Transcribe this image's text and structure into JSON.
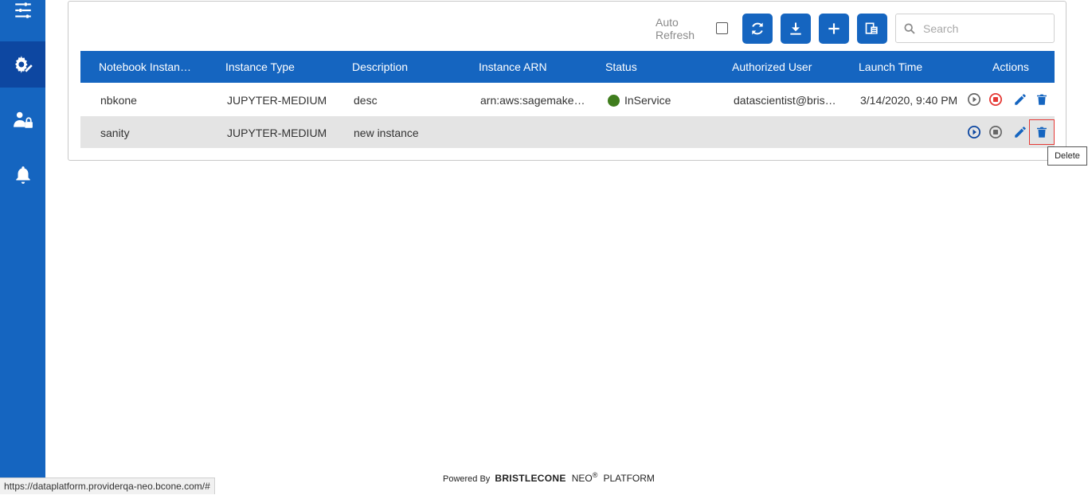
{
  "colors": {
    "primary": "#1565c0",
    "sidebar_active": "#0d47a1",
    "status_green": "#3f7d1d",
    "stop_red": "#e53935"
  },
  "sidebar": {
    "items": [
      {
        "icon": "sliders-icon"
      },
      {
        "icon": "gear-settings-icon",
        "active": true
      },
      {
        "icon": "user-lock-icon"
      },
      {
        "icon": "bell-icon"
      }
    ]
  },
  "toolbar": {
    "auto_refresh_line1": "Auto",
    "auto_refresh_line2": "Refresh",
    "auto_refresh_checked": false,
    "buttons": [
      "refresh-icon",
      "download-icon",
      "plus-icon",
      "export-icon"
    ],
    "search_placeholder": "Search"
  },
  "table": {
    "columns": [
      "Notebook Instan…",
      "Instance Type",
      "Description",
      "Instance ARN",
      "Status",
      "Authorized User",
      "Launch Time",
      "Actions"
    ],
    "rows": [
      {
        "name": "nbkone",
        "type": "JUPYTER-MEDIUM",
        "description": "desc",
        "arn": "arn:aws:sagemake…",
        "status": "InService",
        "user": "datascientist@bris…",
        "launch_time": "3/14/2020, 9:40 PM"
      },
      {
        "name": "sanity",
        "type": "JUPYTER-MEDIUM",
        "description": "new instance",
        "arn": "",
        "status": "",
        "user": "",
        "launch_time": ""
      }
    ]
  },
  "tooltip": "Delete",
  "footer": {
    "powered_by": "Powered By",
    "brand": "BRISTLECONE",
    "neo": "NEO",
    "reg": "®",
    "platform": "PLATFORM"
  },
  "statusbar": {
    "url": "https://dataplatform.providerqa-neo.bcone.com/#"
  }
}
